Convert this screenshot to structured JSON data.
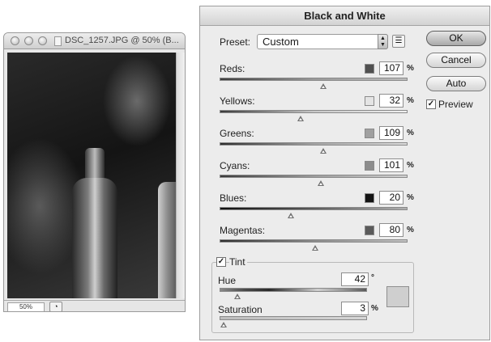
{
  "document_window": {
    "title": "DSC_1257.JPG @ 50% (B...",
    "zoom": "50%"
  },
  "dialog": {
    "title": "Black and White",
    "preset_label": "Preset:",
    "preset_value": "Custom",
    "buttons": {
      "ok": "OK",
      "cancel": "Cancel",
      "auto": "Auto"
    },
    "preview_label": "Preview",
    "preview_checked": true,
    "channels": [
      {
        "label": "Reds:",
        "value": "107",
        "unit": "%",
        "swatch": "#505050",
        "level_fraction": 0.55,
        "track": "linear-gradient(90deg,#3c3c3c,#9a9a9a,#bdbdbd)"
      },
      {
        "label": "Yellows:",
        "value": "32",
        "unit": "%",
        "swatch": "#e4e4e4",
        "level_fraction": 0.43,
        "track": "linear-gradient(90deg,#3a3a3a,#c8c8c8,#f0f0f0)"
      },
      {
        "label": "Greens:",
        "value": "109",
        "unit": "%",
        "swatch": "#a0a0a0",
        "level_fraction": 0.55,
        "track": "linear-gradient(90deg,#2e2e2e,#a5a5a5,#dcdcdc)"
      },
      {
        "label": "Cyans:",
        "value": "101",
        "unit": "%",
        "swatch": "#8c8c8c",
        "level_fraction": 0.54,
        "track": "linear-gradient(90deg,#3a3a3a,#9c9c9c,#d2d2d2)"
      },
      {
        "label": "Blues:",
        "value": "20",
        "unit": "%",
        "swatch": "#141414",
        "level_fraction": 0.38,
        "track": "linear-gradient(90deg,#0e0e0e,#5a5a5a,#b0b0b0)"
      },
      {
        "label": "Magentas:",
        "value": "80",
        "unit": "%",
        "swatch": "#5a5a5a",
        "level_fraction": 0.51,
        "track": "linear-gradient(90deg,#2e2e2e,#8a8a8a,#c4c4c4)"
      }
    ],
    "tint": {
      "label": "Tint",
      "checked": true,
      "hue_label": "Hue",
      "hue_value": "42",
      "hue_unit": "°",
      "hue_fraction": 0.12,
      "saturation_label": "Saturation",
      "saturation_value": "3",
      "saturation_unit": "%",
      "saturation_fraction": 0.03,
      "color": "#cfcfcf"
    }
  }
}
